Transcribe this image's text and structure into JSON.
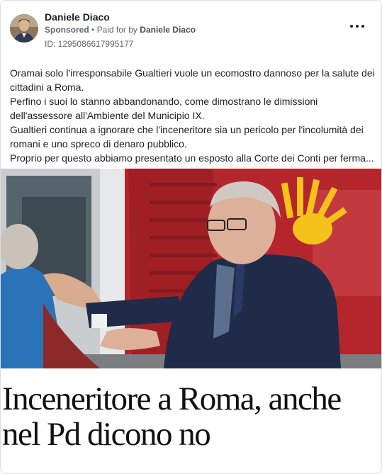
{
  "post": {
    "author": "Daniele Diaco",
    "sponsored": "Sponsored",
    "separator": "•",
    "paid_for_prefix": "Paid for by",
    "paid_for_name": "Daniele Diaco",
    "ad_id": "ID: 1295086617995177",
    "more_icon": "more-horizontal-icon",
    "text_lines": [
      "Oramai solo l'irresponsabile Gualtieri vuole un ecomostro dannoso per la salute dei",
      "cittadini a Roma.",
      "Perfino i suoi lo stanno abbandonando, come dimostrano le dimissioni",
      "dell'assessore all'Ambiente del Municipio IX.",
      "Gualtieri continua a ignorare che l'inceneritore sia un pericolo per l'incolumità dei",
      "romani e uno spreco di denaro pubblico.",
      "Proprio per questo abbiamo presentato un esposto alla Corte dei Conti per ferma..."
    ],
    "headline_lines": [
      "Inceneritore a Roma, anche",
      "nel Pd dicono no"
    ]
  }
}
